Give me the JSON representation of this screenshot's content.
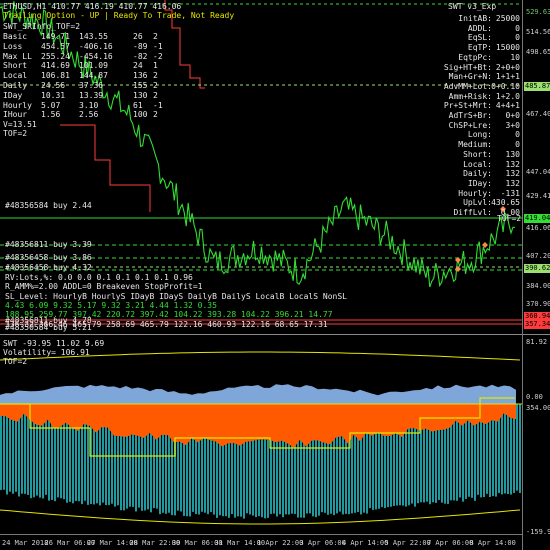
{
  "window": {
    "symbol_title": "ETHUSD,H1",
    "ohlc": "410.77 416.19 410.77 416.06",
    "expert_name": "SWT v3_Exp",
    "status_line": "Trailing Option - UP | Ready To Trade, Not Ready",
    "sr_line": "SWT_SRInfo_TOF=2"
  },
  "stats_left": [
    {
      "label": "Basic",
      "a": "149.71",
      "b": "143.55",
      "c": "26",
      "d": "2"
    },
    {
      "label": "Loss",
      "a": "454.57",
      "b": "-406.16",
      "c": "-89",
      "d": "-1"
    },
    {
      "label": "Max LL",
      "a": "255.24",
      "b": "-454.16",
      "c": "-82",
      "d": "-2"
    },
    {
      "label": "Short",
      "a": "414.69",
      "b": "101.09",
      "c": "24",
      "d": "1"
    },
    {
      "label": "Local",
      "a": "106.81",
      "b": "144.87",
      "c": "136",
      "d": "2"
    },
    {
      "label": "Daily",
      "a": "24.56",
      "b": "37.36",
      "c": "155",
      "d": "2"
    },
    {
      "label": "IDay",
      "a": "10.31",
      "b": "13.39",
      "c": "130",
      "d": "2"
    },
    {
      "label": "Hourly",
      "a": "5.07",
      "b": "3.10",
      "c": "61",
      "d": "-1"
    },
    {
      "label": "IHour",
      "a": "1.56",
      "b": "2.56",
      "c": "100",
      "d": "2"
    }
  ],
  "v_line": "V=13.51",
  "tof_line": "TOF=2",
  "stats_right": [
    {
      "label": "InitAB:",
      "value": "25000"
    },
    {
      "label": "ADDL:",
      "value": "0"
    },
    {
      "label": "EqSL:",
      "value": "0"
    },
    {
      "label": "EqTP:",
      "value": "15000"
    },
    {
      "label": "EqtpPc:",
      "value": "10"
    },
    {
      "label": "Sig+HT+Bt:",
      "value": "2+0+0"
    },
    {
      "label": "Man+Gr+N:",
      "value": "1+1+1"
    },
    {
      "label": "AdvMM+Lot:",
      "value": "0+0.10"
    },
    {
      "label": "Amm+Risk:",
      "value": "1+2.0"
    },
    {
      "label": "Pr+St+Mrt:",
      "value": "4+4+1"
    },
    {
      "label": "AdTrS+Br:",
      "value": "0+0"
    },
    {
      "label": "ChSP+Lre:",
      "value": "3+0"
    },
    {
      "label": "Long:",
      "value": "0"
    },
    {
      "label": "Medium:",
      "value": "0"
    },
    {
      "label": "Short:",
      "value": "130"
    },
    {
      "label": "Local:",
      "value": "132"
    },
    {
      "label": "Daily:",
      "value": "132"
    },
    {
      "label": "IDay:",
      "value": "132"
    },
    {
      "label": "Hourly:",
      "value": "-131"
    },
    {
      "label": "UpLvl:",
      "value": "430.65"
    },
    {
      "label": "DiffLvl:",
      "value": "0.00"
    }
  ],
  "trade_labels": [
    {
      "text": "#48356584 buy 2.44"
    },
    {
      "text": "#48356811 buy 3.39"
    },
    {
      "text": "#48356458 buy 3.86"
    },
    {
      "text": "#48356458 buy 4.32"
    },
    {
      "text": "#48356811 buy 4.78"
    },
    {
      "text": "#48350584 buy 5.21"
    }
  ],
  "tof_marker": "TOF=2",
  "lower_block": {
    "line1": "RV:Lots,%: 0.0   0.0   0.1   0.1   0.1   0.1   0.96",
    "line2": "R_AMM%=2.00         ADDL=0          Breakeven StopProfit=1",
    "line3": "SL_Level:  HourlyB  HourlyS  IDayB  IDayS  DailyB  DailyS  LocalB  LocalS  NonSL",
    "line4": "4.43       6.09     9.32     5.17   9.32   3.21   4.44    1.32    0.35",
    "line5": "188.95     259.77   397.42   220.72  397.42  104.22  393.28  104.22  396.21  14.77",
    "line6": "336.32     366.46   465.79   258.69  465.79  122.16  460.93  122.16  68.65   17.31"
  },
  "sub_window": {
    "title": "SWT -93.95 11.02 9.69",
    "volatility": "Volatility= 106.91",
    "tof": "TOF=2"
  },
  "price_axis_main": [
    {
      "text": "529.63",
      "color": "#6ec46e"
    },
    {
      "text": "514.56"
    },
    {
      "text": "498.65"
    },
    {
      "text": "485.87",
      "box": "#9be06f"
    },
    {
      "text": "467.40"
    },
    {
      "text": "447.04"
    },
    {
      "text": "429.41"
    },
    {
      "text": "419.04",
      "box": "#33dd33"
    },
    {
      "text": "416.06"
    },
    {
      "text": "407.20"
    },
    {
      "text": "390.62",
      "box": "#9be06f"
    },
    {
      "text": "384.00"
    },
    {
      "text": "370.90"
    },
    {
      "text": "360.94",
      "box": "#ff3b3b"
    },
    {
      "text": "357.34",
      "box": "#ff3b3b"
    }
  ],
  "price_axis_sub": [
    {
      "text": "81.92"
    },
    {
      "text": "0.00"
    },
    {
      "text": "354.00"
    },
    {
      "text": "-159.97"
    }
  ],
  "time_axis": [
    "24 Mar 2018",
    "26 Mar 06:00",
    "27 Mar 14:00",
    "28 Mar 22:00",
    "30 Mar 06:00",
    "31 Mar 14:00",
    "1 Apr 22:00",
    "3 Apr 06:00",
    "4 Apr 14:00",
    "5 Apr 22:00",
    "7 Apr 06:00",
    "8 Apr 14:00"
  ],
  "colors": {
    "price_up": "#33dd33",
    "price_down": "#33dd33",
    "yellow": "#e6e600",
    "red": "#ff3b3b",
    "orange": "#ff5a00",
    "blue": "#7ea6d8",
    "teal": "#1f9aa0"
  },
  "chart_data": {
    "type": "line",
    "title": "ETHUSD,H1",
    "xlabel": "",
    "ylabel": "",
    "ylim": [
      357,
      530
    ],
    "x": [
      "24 Mar 2018",
      "26 Mar 06:00",
      "27 Mar 14:00",
      "28 Mar 22:00",
      "30 Mar 06:00",
      "31 Mar 14:00",
      "1 Apr 22:00",
      "3 Apr 06:00",
      "4 Apr 14:00",
      "5 Apr 22:00",
      "7 Apr 06:00",
      "8 Apr 14:00",
      "9 Apr"
    ],
    "series": [
      {
        "values": [
          528,
          520,
          495,
          470,
          430,
          390,
          398,
          385,
          420,
          405,
          382,
          392,
          415
        ]
      }
    ]
  }
}
